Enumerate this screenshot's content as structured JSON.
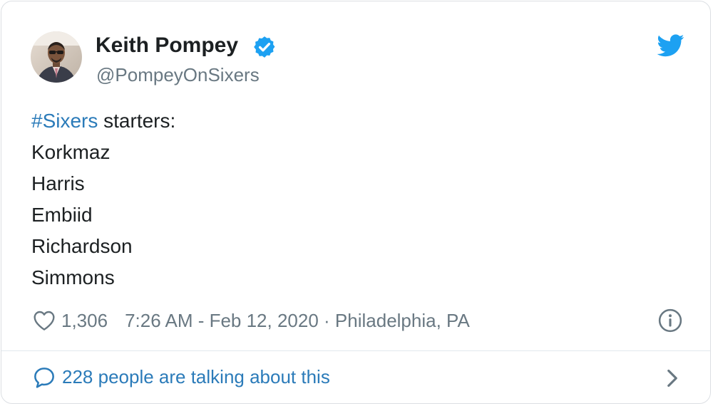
{
  "author": {
    "name": "Keith Pompey",
    "handle": "@PompeyOnSixers",
    "verified": true
  },
  "tweet": {
    "hashtag": "#Sixers",
    "intro": " starters:",
    "lines": [
      "Korkmaz",
      "Harris",
      "Embiid",
      "Richardson",
      "Simmons"
    ]
  },
  "meta": {
    "likes": "1,306",
    "timestamp": "7:26 AM - Feb 12, 2020 · Philadelphia, PA"
  },
  "footer": {
    "talking": "228 people are talking about this"
  },
  "icons": {
    "verified": "verified-badge-icon",
    "brand": "twitter-bird-icon",
    "like": "heart-icon",
    "info": "info-icon",
    "reply": "speech-bubble-icon",
    "more": "chevron-right-icon"
  },
  "colors": {
    "brand_blue": "#1da1f2",
    "link_blue": "#2b7bb9",
    "text_dark": "#1c2022",
    "text_gray": "#697882"
  }
}
